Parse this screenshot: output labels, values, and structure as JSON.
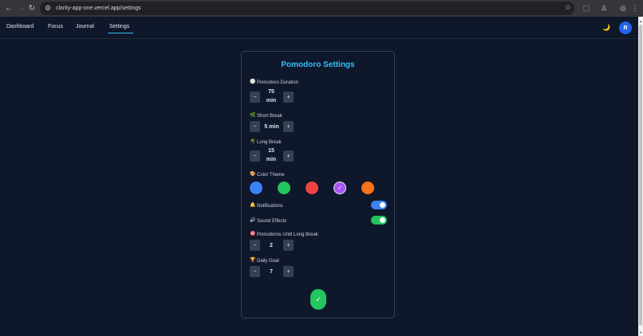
{
  "browser": {
    "back_icon": "←",
    "forward_icon": "→",
    "reload_icon": "↻",
    "tune_icon": "⚙",
    "url": "clarity-app-one.vercel.app/settings",
    "bookmark_icon": "☆",
    "extensions_icon": "⬚",
    "profile_icon": "♙",
    "account_icon": "◎",
    "menu_icon": "⋮"
  },
  "nav": {
    "links": [
      "Dashboard",
      "Focus",
      "Journal",
      "Settings"
    ],
    "active": "Settings",
    "theme_icon": "🌙",
    "avatar_initial": "R"
  },
  "card": {
    "title": "Pomodoro Settings",
    "pomodoro": {
      "icon": "⚪",
      "label": "Pomodoro Duration",
      "value_num": "75",
      "value_unit": "min"
    },
    "short_break": {
      "icon": "🌿",
      "label": "Short Break",
      "value": "5 min"
    },
    "long_break": {
      "icon": "🌴",
      "label": "Long Break",
      "value_num": "15",
      "value_unit": "min"
    },
    "color_theme": {
      "icon": "🎨",
      "label": "Color Theme",
      "colors": [
        "#3b82f6",
        "#22c55e",
        "#ef4444",
        "#a855f7",
        "#f97316"
      ],
      "selected_index": 3,
      "check_icon": "✓"
    },
    "notifications": {
      "icon": "🔔",
      "label": "Notifications",
      "enabled": true,
      "color": "#3b82f6"
    },
    "sound_effects": {
      "icon": "🔊",
      "label": "Sound Effects",
      "enabled": true,
      "color": "#22c55e"
    },
    "pomodoros_until_long_break": {
      "icon": "🎯",
      "label": "Pomodoros Until Long Break",
      "value": "2"
    },
    "daily_goal": {
      "icon": "🏆",
      "label": "Daily Goal",
      "value": "7"
    },
    "minus_symbol": "−",
    "plus_symbol": "+",
    "save_icon": "✓"
  }
}
